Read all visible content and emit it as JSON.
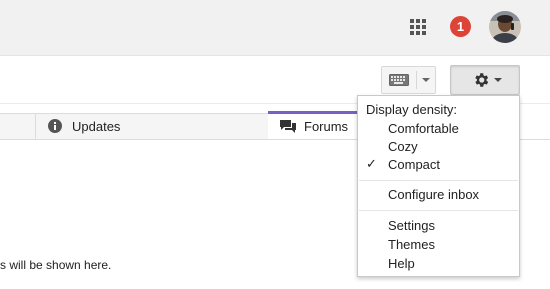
{
  "header": {
    "notification_count": "1",
    "icons": {
      "apps": "apps-grid-icon",
      "avatar": "user-avatar"
    },
    "colors": {
      "badge": "#db4437",
      "bar": "#f1f1f1"
    }
  },
  "toolbar": {
    "keyboard_icon": "keyboard-icon",
    "settings_icon": "gear-icon"
  },
  "tabs": [
    {
      "label": "Updates",
      "icon": "info-icon",
      "active": false
    },
    {
      "label": "Forums",
      "icon": "forum-icon",
      "active": true
    }
  ],
  "accent_color": "#7b5fc4",
  "main": {
    "empty_message": "s will be shown here."
  },
  "settings_menu": {
    "heading": "Display density:",
    "density_options": [
      {
        "label": "Comfortable",
        "checked": false
      },
      {
        "label": "Cozy",
        "checked": false
      },
      {
        "label": "Compact",
        "checked": true
      }
    ],
    "check_mark": "✓",
    "configure_label": "Configure inbox",
    "items": [
      {
        "label": "Settings"
      },
      {
        "label": "Themes"
      },
      {
        "label": "Help"
      }
    ]
  }
}
